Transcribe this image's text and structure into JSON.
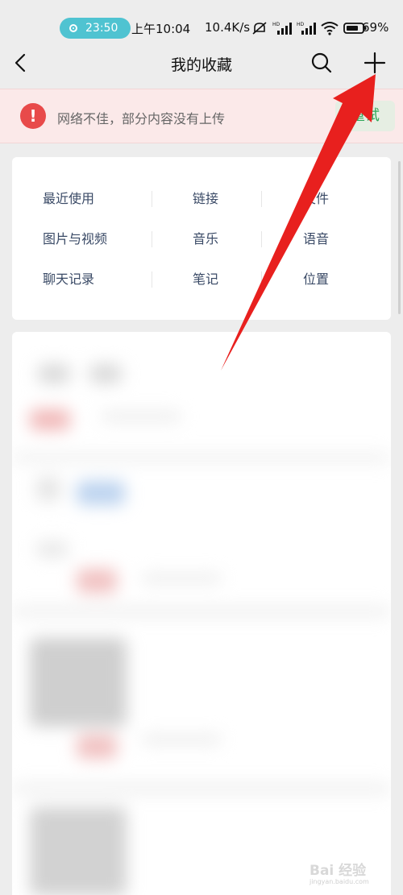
{
  "status_bar": {
    "call_time": "23:50",
    "clock": "上午10:04",
    "net_speed": "10.4K/s",
    "battery": "69%"
  },
  "nav": {
    "title": "我的收藏"
  },
  "banner": {
    "message": "网络不佳，部分内容没有上传",
    "retry_label": "重试",
    "icon": "!"
  },
  "categories": {
    "row1": [
      "最近使用",
      "链接",
      "文件"
    ],
    "row2": [
      "图片与视频",
      "音乐",
      "语音"
    ],
    "row3": [
      "聊天记录",
      "笔记",
      "位置"
    ]
  },
  "watermark": {
    "brand": "Bai 经验",
    "url": "jingyan.baidu.com"
  },
  "colors": {
    "accent_green": "#2fa85a",
    "alert_red": "#e84a4a",
    "annotation_arrow": "#e8201e"
  }
}
